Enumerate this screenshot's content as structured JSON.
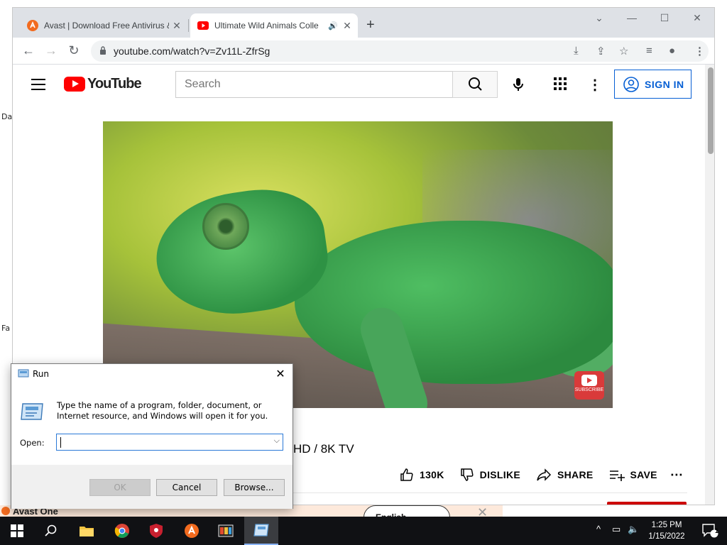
{
  "desktop": {
    "labels": [
      "Da",
      "Fa"
    ]
  },
  "browser": {
    "tabs": [
      {
        "title": "Avast | Download Free Antivirus &",
        "active": false
      },
      {
        "title": "Ultimate Wild Animals Colle",
        "active": true
      }
    ],
    "new_tab": "+",
    "url": "youtube.com/watch?v=Zv11L-ZfrSg"
  },
  "youtube": {
    "logo_text": "YouTube",
    "search_placeholder": "Search",
    "sign_in": "SIGN IN",
    "video_title_partial": "HD / 8K TV",
    "subscribe_badge": "SUBSCRIBE",
    "actions": {
      "like_count": "130K",
      "dislike": "DISLIKE",
      "share": "SHARE",
      "save": "SAVE"
    }
  },
  "run_dialog": {
    "title": "Run",
    "description": "Type the name of a program, folder, document, or Internet resource, and Windows will open it for you.",
    "open_label": "Open:",
    "open_value": "",
    "ok": "OK",
    "cancel": "Cancel",
    "browse": "Browse..."
  },
  "avast_banner": {
    "name": "Avast One",
    "language": "English"
  },
  "taskbar": {
    "time": "1:25 PM",
    "date": "1/15/2022",
    "notification_count": "1"
  }
}
